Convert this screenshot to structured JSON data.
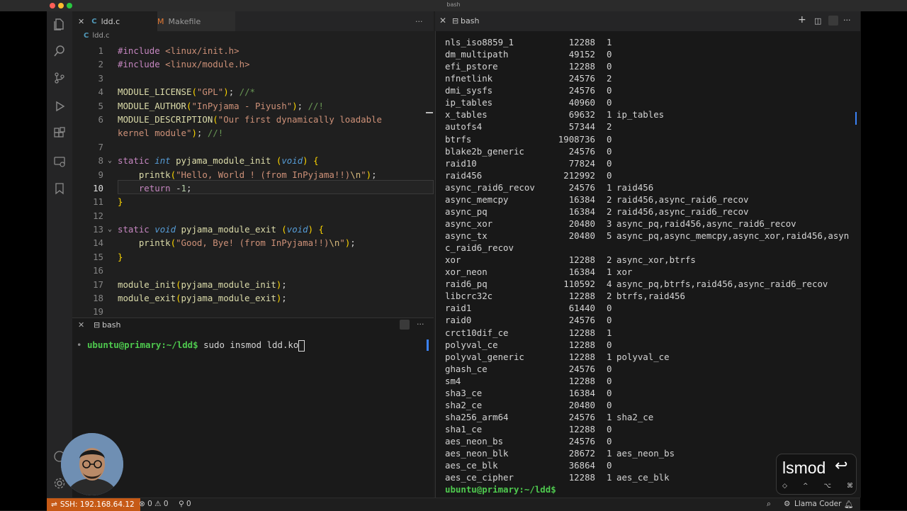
{
  "window": {
    "title": "bash"
  },
  "editor": {
    "tabs": [
      {
        "label": "ldd.c",
        "active": true
      },
      {
        "label": "Makefile",
        "active": false
      }
    ],
    "breadcrumb": "ldd.c",
    "lines": [
      {
        "n": "1",
        "html": "<span class='k-dir'>#include</span> <span class='k-str'>&lt;linux/init.h&gt;</span>"
      },
      {
        "n": "2",
        "html": "<span class='k-dir'>#include</span> <span class='k-str'>&lt;linux/module.h&gt;</span>"
      },
      {
        "n": "3",
        "html": ""
      },
      {
        "n": "4",
        "html": "<span class='k-fn'>MODULE_LICENSE</span><span class='k-paren'>(</span><span class='k-str'>\"GPL\"</span><span class='k-paren'>)</span>; <span class='k-cmt'>//*</span>"
      },
      {
        "n": "5",
        "html": "<span class='k-fn'>MODULE_AUTHOR</span><span class='k-paren'>(</span><span class='k-str'>\"InPyjama - Piyush\"</span><span class='k-paren'>)</span>; <span class='k-cmt'>//!</span>"
      },
      {
        "n": "6",
        "html": "<span class='k-fn'>MODULE_DESCRIPTION</span><span class='k-paren'>(</span><span class='k-str'>\"Our first dynamically loadable</span>"
      },
      {
        "n": "",
        "html": "<span class='k-str'>kernel module\"</span><span class='k-paren'>)</span>; <span class='k-cmt'>//!</span>"
      },
      {
        "n": "7",
        "html": ""
      },
      {
        "n": "8",
        "fold": true,
        "html": "<span class='k-kw'>static</span> <span class='k-type'>int</span> <span class='k-fn'>pyjama_module_init</span> <span class='k-paren'>(</span><span class='k-type'>void</span><span class='k-paren'>)</span> <span class='k-paren'>{</span>"
      },
      {
        "n": "9",
        "html": "    <span class='k-fn'>printk</span><span class='k-paren'>(</span><span class='k-str'>\"Hello, World ! (from InPyjama!!)</span><span class='k-esc'>\\n</span><span class='k-str'>\"</span><span class='k-paren'>)</span>;"
      },
      {
        "n": "10",
        "active": true,
        "html": "    <span class='k-kw'>return</span> -<span class='k-num'>1</span>;"
      },
      {
        "n": "11",
        "html": "<span class='k-paren'>}</span>"
      },
      {
        "n": "12",
        "html": ""
      },
      {
        "n": "13",
        "fold": true,
        "html": "<span class='k-kw'>static</span> <span class='k-type'>void</span> <span class='k-fn'>pyjama_module_exit</span> <span class='k-paren'>(</span><span class='k-type'>void</span><span class='k-paren'>)</span> <span class='k-paren'>{</span>"
      },
      {
        "n": "14",
        "html": "    <span class='k-fn'>printk</span><span class='k-paren'>(</span><span class='k-str'>\"Good, Bye! (from InPyjama!!)</span><span class='k-esc'>\\n</span><span class='k-str'>\"</span><span class='k-paren'>)</span>;"
      },
      {
        "n": "15",
        "html": "<span class='k-paren'>}</span>"
      },
      {
        "n": "16",
        "html": ""
      },
      {
        "n": "17",
        "html": "<span class='k-fn'>module_init</span><span class='k-paren'>(</span><span class='k-fn'>pyjama_module_init</span><span class='k-paren'>)</span>;"
      },
      {
        "n": "18",
        "html": "<span class='k-fn'>module_exit</span><span class='k-paren'>(</span><span class='k-fn'>pyjama_module_exit</span><span class='k-paren'>)</span>;"
      },
      {
        "n": "19",
        "html": ""
      }
    ]
  },
  "bottom_terminal": {
    "tab_label": "bash",
    "prompt": "ubuntu@primary:~/ldd$",
    "command": "sudo insmod ldd.ko"
  },
  "right_terminal": {
    "tab_label": "bash",
    "modules": [
      [
        "nls_iso8859_1",
        "12288",
        "1",
        ""
      ],
      [
        "dm_multipath",
        "49152",
        "0",
        ""
      ],
      [
        "efi_pstore",
        "12288",
        "0",
        ""
      ],
      [
        "nfnetlink",
        "24576",
        "2",
        ""
      ],
      [
        "dmi_sysfs",
        "24576",
        "0",
        ""
      ],
      [
        "ip_tables",
        "40960",
        "0",
        ""
      ],
      [
        "x_tables",
        "69632",
        "1",
        "ip_tables"
      ],
      [
        "autofs4",
        "57344",
        "2",
        ""
      ],
      [
        "btrfs",
        "1908736",
        "0",
        ""
      ],
      [
        "blake2b_generic",
        "24576",
        "0",
        ""
      ],
      [
        "raid10",
        "77824",
        "0",
        ""
      ],
      [
        "raid456",
        "212992",
        "0",
        ""
      ],
      [
        "async_raid6_recov",
        "24576",
        "1",
        "raid456"
      ],
      [
        "async_memcpy",
        "16384",
        "2",
        "raid456,async_raid6_recov"
      ],
      [
        "async_pq",
        "16384",
        "2",
        "raid456,async_raid6_recov"
      ],
      [
        "async_xor",
        "20480",
        "3",
        "async_pq,raid456,async_raid6_recov"
      ],
      [
        "async_tx",
        "20480",
        "5",
        "async_pq,async_memcpy,async_xor,raid456,asyn"
      ],
      [
        "c_raid6_recov",
        "",
        "",
        ""
      ],
      [
        "xor",
        "12288",
        "2",
        "async_xor,btrfs"
      ],
      [
        "xor_neon",
        "16384",
        "1",
        "xor"
      ],
      [
        "raid6_pq",
        "110592",
        "4",
        "async_pq,btrfs,raid456,async_raid6_recov"
      ],
      [
        "libcrc32c",
        "12288",
        "2",
        "btrfs,raid456"
      ],
      [
        "raid1",
        "61440",
        "0",
        ""
      ],
      [
        "raid0",
        "24576",
        "0",
        ""
      ],
      [
        "crct10dif_ce",
        "12288",
        "1",
        ""
      ],
      [
        "polyval_ce",
        "12288",
        "0",
        ""
      ],
      [
        "polyval_generic",
        "12288",
        "1",
        "polyval_ce"
      ],
      [
        "ghash_ce",
        "24576",
        "0",
        ""
      ],
      [
        "sm4",
        "12288",
        "0",
        ""
      ],
      [
        "sha3_ce",
        "16384",
        "0",
        ""
      ],
      [
        "sha2_ce",
        "20480",
        "0",
        ""
      ],
      [
        "sha256_arm64",
        "24576",
        "1",
        "sha2_ce"
      ],
      [
        "sha1_ce",
        "12288",
        "0",
        ""
      ],
      [
        "aes_neon_bs",
        "24576",
        "0",
        ""
      ],
      [
        "aes_neon_blk",
        "28672",
        "1",
        "aes_neon_bs"
      ],
      [
        "aes_ce_blk",
        "36864",
        "0",
        ""
      ],
      [
        "aes_ce_cipher",
        "12288",
        "1",
        "aes_ce_blk"
      ]
    ],
    "prompt": "ubuntu@primary:~/ldd$"
  },
  "keycast": {
    "text": "lsmod",
    "symbol": "↩",
    "modifiers": [
      "◇",
      "^",
      "⌥",
      "⌘"
    ]
  },
  "statusbar": {
    "remote": "SSH: 192.168.64.12",
    "problems": "⊗ 0 ⚠ 0",
    "ports": "⚲ 0",
    "llama": "Llama Coder"
  },
  "colors": {
    "remote_bg": "#c65a16",
    "prompt_green": "#4ec94e",
    "path_blue": "#6fb0ff"
  }
}
